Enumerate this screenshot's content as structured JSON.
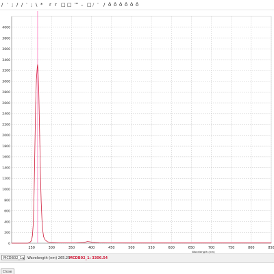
{
  "toolbar": {
    "glyphs": [
      "/",
      "'",
      ";",
      "/",
      "/",
      "'",
      ";",
      "\\",
      "*",
      "r",
      "r",
      "□",
      "□",
      "™",
      "–",
      "□",
      "/",
      "'",
      "/",
      "ô",
      "ô",
      "ô",
      "ô",
      "ô",
      "ô"
    ]
  },
  "status": {
    "channel_label": "MCDB02_1",
    "wavelength_label": "Wavelength (nm) 265.25",
    "readout": "MCDB02_1: 3306.54"
  },
  "bottom": {
    "button_label": "Close",
    "note": ""
  },
  "colors": {
    "spectrum_line": "#d01c3a",
    "cursor_line": "#ff77bd",
    "grid": "#b9b9b9",
    "axis_text": "#222222"
  },
  "chart_data": {
    "type": "line",
    "title": "",
    "xlabel": "Wavelength (nm)",
    "ylabel": "",
    "xlim": [
      200,
      850
    ],
    "ylim": [
      0,
      4200
    ],
    "xticks": [
      250,
      300,
      350,
      400,
      450,
      500,
      550,
      600,
      650,
      700,
      750,
      800,
      850
    ],
    "yticks": [
      0,
      200,
      400,
      600,
      800,
      1000,
      1200,
      1400,
      1600,
      1800,
      2000,
      2200,
      2400,
      2600,
      2800,
      3000,
      3200,
      3400,
      3600,
      3800,
      4000
    ],
    "grid": true,
    "legend": "none",
    "cursor_x": 265,
    "series": [
      {
        "x": [
          200,
          235,
          240,
          245,
          250,
          252,
          254,
          256,
          258,
          260,
          262,
          264,
          265,
          266,
          268,
          270,
          272,
          274,
          276,
          278,
          280,
          284,
          290,
          300,
          320,
          360,
          380,
          390,
          400,
          410,
          420,
          440,
          500,
          550,
          600,
          650,
          700,
          750,
          800,
          850
        ],
        "y": [
          0,
          0,
          0,
          10,
          50,
          140,
          350,
          850,
          1700,
          2550,
          3030,
          3250,
          3306,
          3200,
          2800,
          2050,
          1300,
          760,
          420,
          230,
          120,
          60,
          25,
          10,
          5,
          5,
          12,
          30,
          20,
          12,
          8,
          5,
          4,
          4,
          4,
          4,
          4,
          4,
          4,
          4
        ]
      }
    ]
  }
}
